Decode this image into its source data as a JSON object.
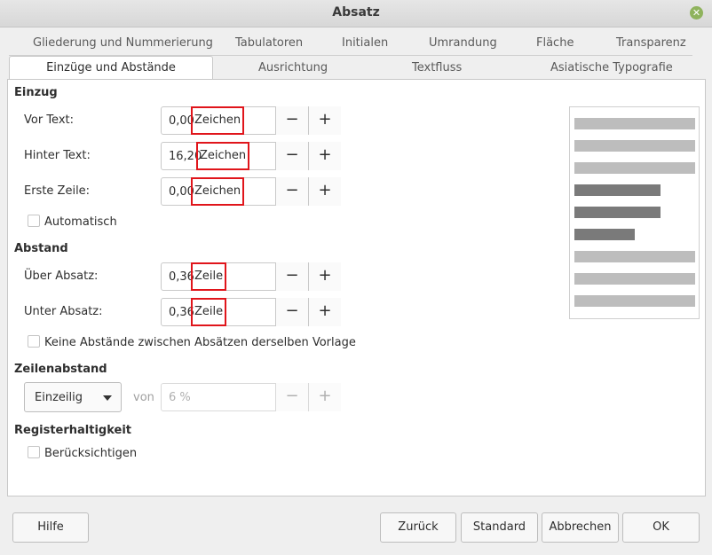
{
  "window": {
    "title": "Absatz"
  },
  "tabs_row1": [
    "Gliederung und Nummerierung",
    "Tabulatoren",
    "Initialen",
    "Umrandung",
    "Fläche",
    "Transparenz"
  ],
  "tabs_row2": [
    "Einzüge und Abstände",
    "Ausrichtung",
    "Textfluss",
    "Asiatische Typografie"
  ],
  "indent": {
    "heading": "Einzug",
    "before_text": {
      "label": "Vor Text:",
      "value": "0,00",
      "unit": "Zeichen"
    },
    "after_text": {
      "label": "Hinter Text:",
      "value": "16,20",
      "unit": "Zeichen"
    },
    "first_line": {
      "label": "Erste Zeile:",
      "value": "0,00",
      "unit": "Zeichen"
    },
    "automatic": {
      "label": "Automatisch",
      "checked": false
    }
  },
  "spacing": {
    "heading": "Abstand",
    "above": {
      "label": "Über Absatz:",
      "value": "0,36",
      "unit": "Zeile"
    },
    "below": {
      "label": "Unter Absatz:",
      "value": "0,36",
      "unit": "Zeile"
    },
    "no_space_same_style": {
      "label": "Keine Abstände zwischen Absätzen derselben Vorlage",
      "checked": false
    }
  },
  "line_spacing": {
    "heading": "Zeilenabstand",
    "selected": "Einzeilig",
    "of_label": "von",
    "value": "6 %"
  },
  "register": {
    "heading": "Registerhaltigkeit",
    "activate": {
      "label": "Berücksichtigen",
      "checked": false
    }
  },
  "stepper": {
    "minus": "−",
    "plus": "+"
  },
  "buttons": {
    "help": "Hilfe",
    "reset": "Zurück",
    "standard": "Standard",
    "cancel": "Abbrechen",
    "ok": "OK"
  },
  "icons": {
    "close": "close-icon",
    "dropdown": "chevron-down-icon"
  },
  "colors": {
    "highlight": "#e0151b",
    "close_button": "#8fb35d"
  }
}
